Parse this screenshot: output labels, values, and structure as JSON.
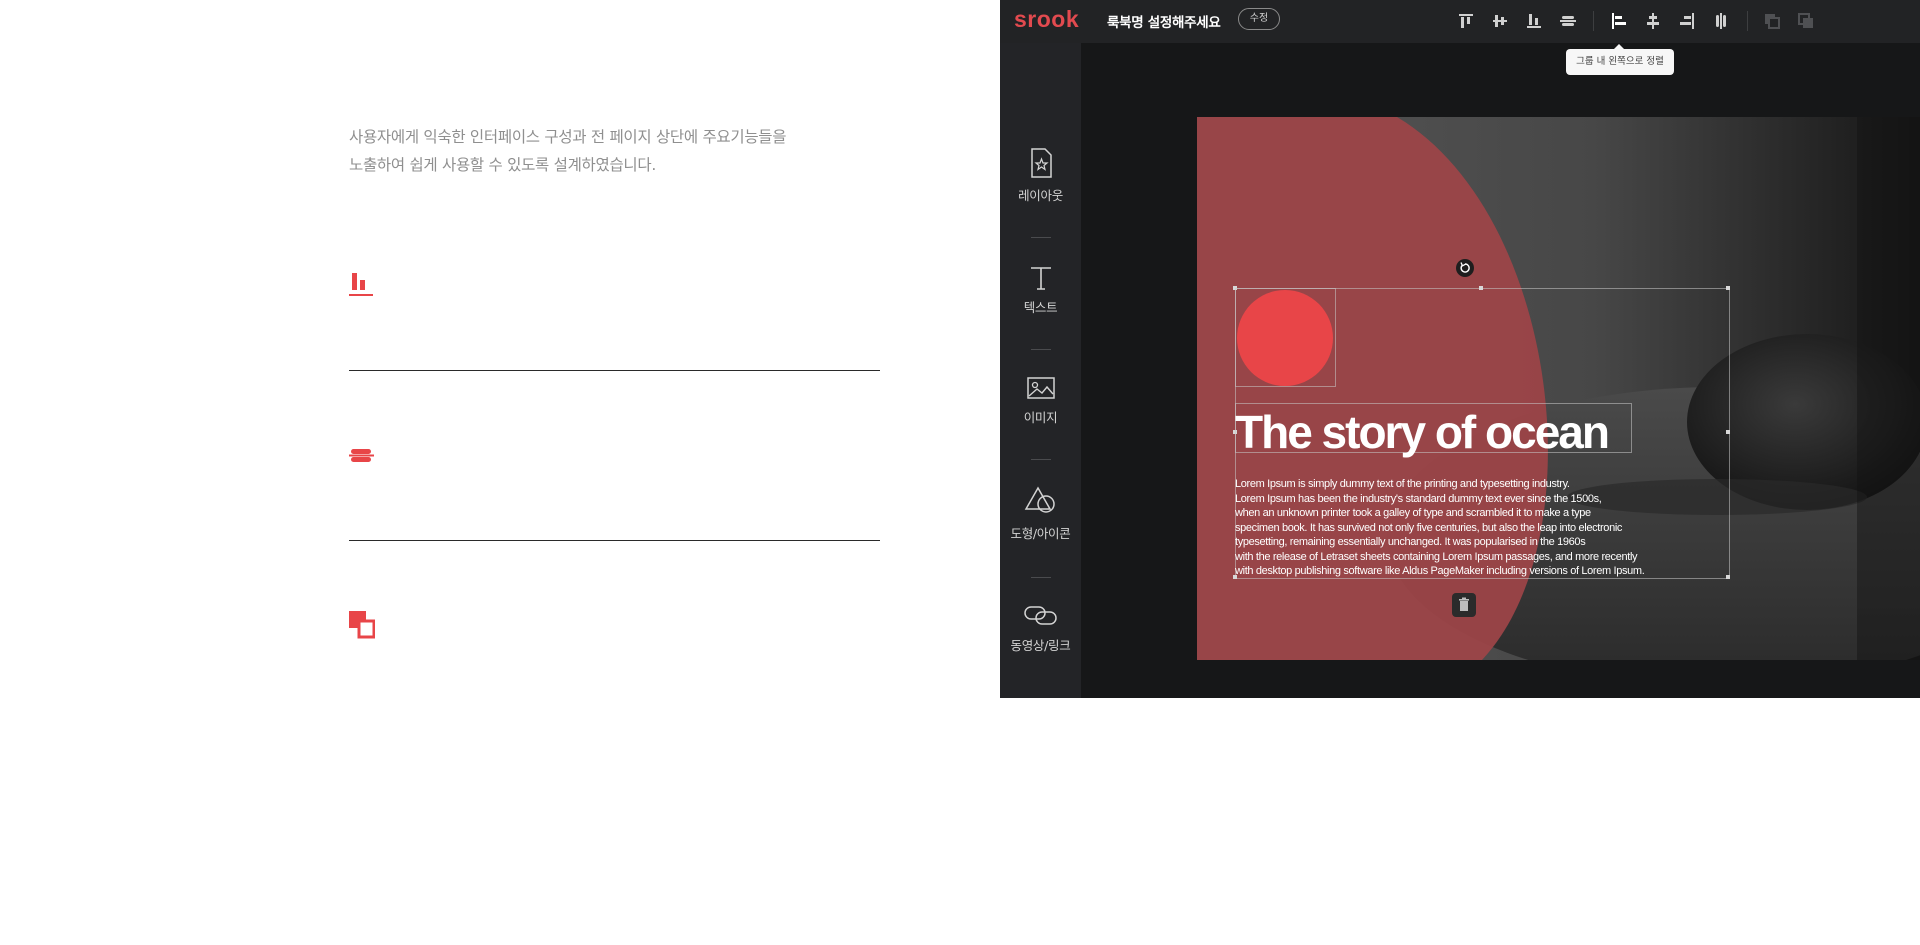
{
  "intro": {
    "line1": "사용자에게 익숙한 인터페이스 구성과 전 페이지 상단에 주요기능들을",
    "line2": "노출하여 쉽게 사용할 수 있도록 설계하였습니다."
  },
  "features": [
    {
      "icon": "align-bottom-icon"
    },
    {
      "icon": "align-center-icon"
    },
    {
      "icon": "layer-order-icon"
    }
  ],
  "editor": {
    "logo": "srook",
    "book_title": "룩북명 설정해주세요",
    "edit_label": "수정",
    "toolbar_icons": [
      "align-top-icon",
      "align-middle-icon",
      "align-bottom-icon",
      "distribute-vertical-icon",
      "align-left-icon",
      "align-center-icon",
      "align-right-icon",
      "distribute-horizontal-icon",
      "bring-forward-icon",
      "send-backward-icon"
    ],
    "tooltip": "그룹 내 왼쪽으로 정렬",
    "sidebar": [
      {
        "label": "레이아웃",
        "icon": "layout-icon"
      },
      {
        "label": "텍스트",
        "icon": "text-icon"
      },
      {
        "label": "이미지",
        "icon": "image-icon"
      },
      {
        "label": "도형/아이콘",
        "icon": "shape-icon"
      },
      {
        "label": "동영상/링크",
        "icon": "link-icon"
      }
    ],
    "canvas": {
      "headline": "The story of ocean",
      "body_lines": [
        "Lorem Ipsum is simply dummy text of the printing and typesetting industry.",
        "Lorem Ipsum has been the industry's standard dummy text ever since the 1500s,",
        "when an unknown printer took a galley of type and scrambled it to make a type",
        " specimen book. It has survived not only five centuries, but also the leap into electronic",
        "typesetting, remaining essentially unchanged. It was popularised in the 1960s",
        "with the release of Letraset sheets containing Lorem Ipsum passages, and more recently",
        "with desktop publishing software like Aldus PageMaker including versions of Lorem Ipsum."
      ]
    }
  },
  "colors": {
    "accent": "#e84548",
    "dark_bg": "#161718",
    "topbar_bg": "#222325",
    "sidebar_bg": "#232427",
    "semi_circle": "#9c4548"
  }
}
